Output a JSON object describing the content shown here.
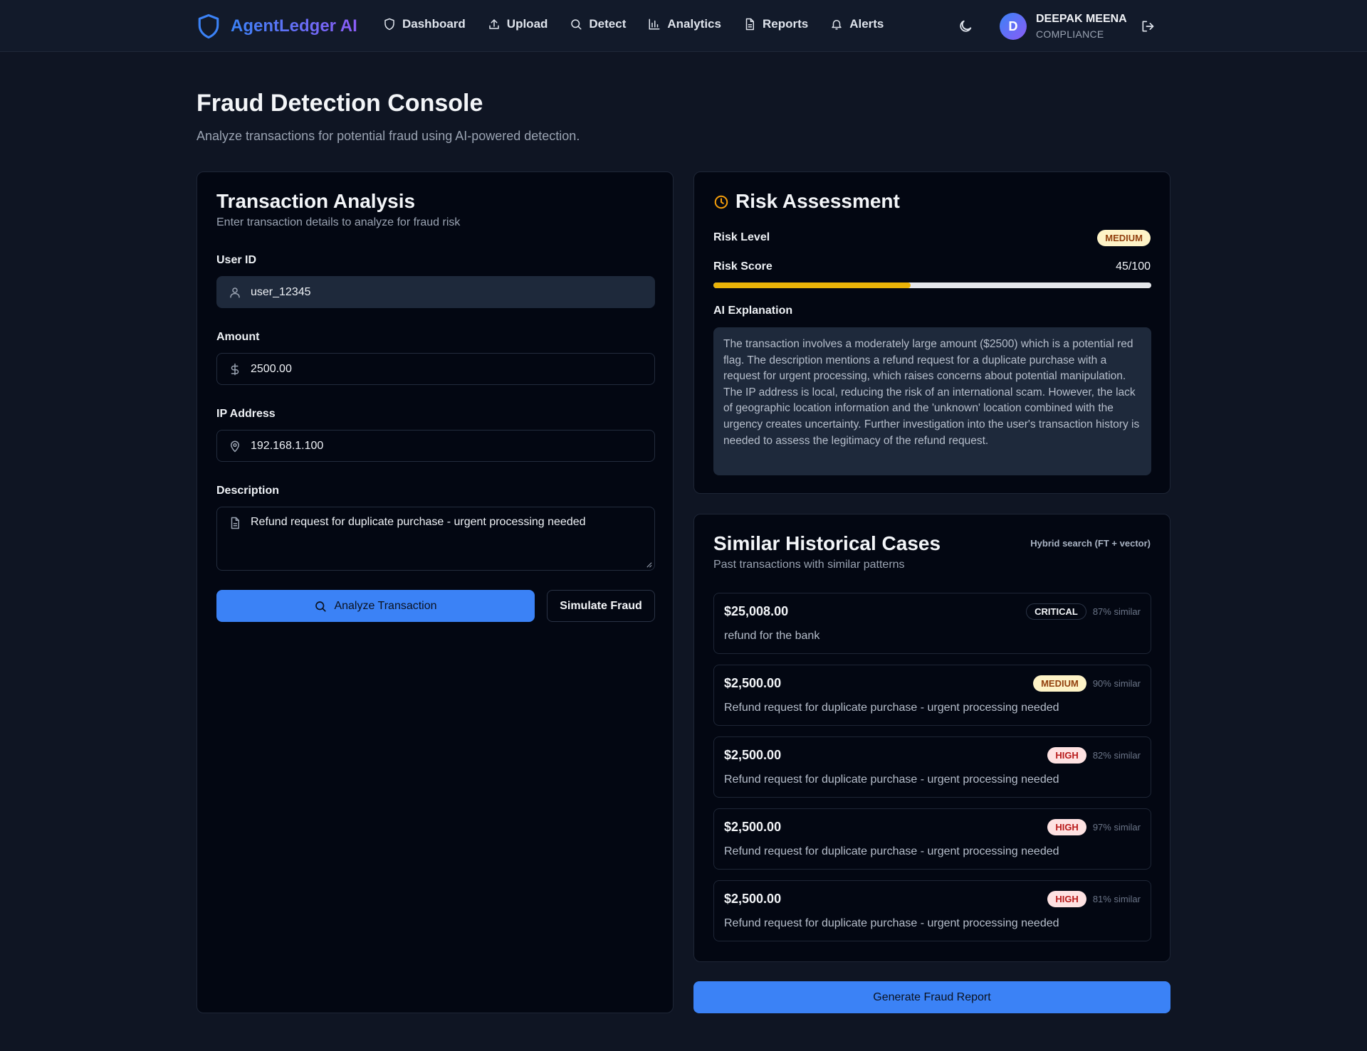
{
  "nav": {
    "brand": "AgentLedger AI",
    "links": [
      {
        "label": "Dashboard",
        "icon": "shield-icon"
      },
      {
        "label": "Upload",
        "icon": "upload-icon"
      },
      {
        "label": "Detect",
        "icon": "search-icon"
      },
      {
        "label": "Analytics",
        "icon": "bar-chart-icon"
      },
      {
        "label": "Reports",
        "icon": "document-icon"
      },
      {
        "label": "Alerts",
        "icon": "bell-icon"
      }
    ],
    "user": {
      "initial": "D",
      "name": "DEEPAK MEENA",
      "role": "COMPLIANCE"
    }
  },
  "header": {
    "title": "Fraud Detection Console",
    "subtitle": "Analyze transactions for potential fraud using AI-powered detection."
  },
  "analysis": {
    "title": "Transaction Analysis",
    "subtitle": "Enter transaction details to analyze for fraud risk",
    "user_id_label": "User ID",
    "user_id_value": "user_12345",
    "amount_label": "Amount",
    "amount_value": "2500.00",
    "ip_label": "IP Address",
    "ip_value": "192.168.1.100",
    "description_label": "Description",
    "description_value": "Refund request for duplicate purchase - urgent processing needed",
    "analyze_button": "Analyze Transaction",
    "simulate_button": "Simulate Fraud"
  },
  "risk": {
    "title": "Risk Assessment",
    "level_label": "Risk Level",
    "level_value": "MEDIUM",
    "score_label": "Risk Score",
    "score_text": "45/100",
    "score_fraction": 0.45,
    "explanation_label": "AI Explanation",
    "explanation": "The transaction involves a moderately large amount ($2500) which is a potential red flag. The description mentions a refund request for a duplicate purchase with a request for urgent processing, which raises concerns about potential manipulation. The IP address is local, reducing the risk of an international scam. However, the lack of geographic location information and the 'unknown' location combined with the urgency creates uncertainty. Further investigation into the user's transaction history is needed to assess the legitimacy of the refund request."
  },
  "history": {
    "title": "Similar Historical Cases",
    "subtitle": "Past transactions with similar patterns",
    "search_note": "Hybrid search (FT + vector)",
    "cases": [
      {
        "amount": "$25,008.00",
        "description": "refund for the bank",
        "level": "CRITICAL",
        "similarity": "87% similar"
      },
      {
        "amount": "$2,500.00",
        "description": "Refund request for duplicate purchase - urgent processing needed",
        "level": "MEDIUM",
        "similarity": "90% similar"
      },
      {
        "amount": "$2,500.00",
        "description": "Refund request for duplicate purchase - urgent processing needed",
        "level": "HIGH",
        "similarity": "82% similar"
      },
      {
        "amount": "$2,500.00",
        "description": "Refund request for duplicate purchase - urgent processing needed",
        "level": "HIGH",
        "similarity": "97% similar"
      },
      {
        "amount": "$2,500.00",
        "description": "Refund request for duplicate purchase - urgent processing needed",
        "level": "HIGH",
        "similarity": "81% similar"
      }
    ]
  },
  "report_button": "Generate Fraud Report",
  "colors": {
    "accent": "#3b82f6",
    "background": "#0f1523",
    "card": "#030712",
    "medium_badge": "#fef3c7",
    "high_badge": "#fee2e2",
    "progress_fill": "#eab308"
  }
}
